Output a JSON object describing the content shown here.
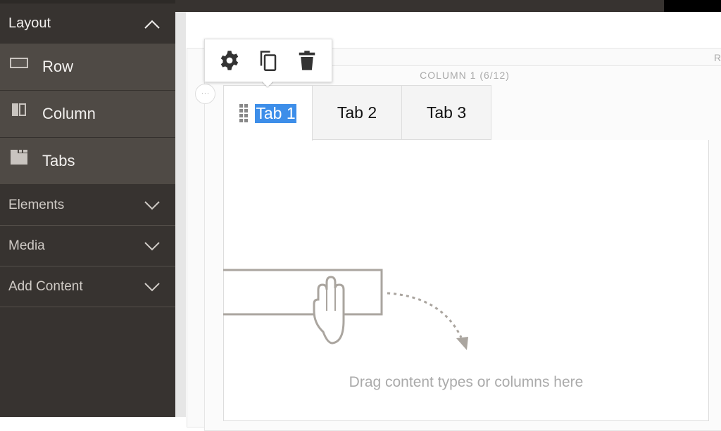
{
  "sidebar": {
    "layout": {
      "label": "Layout",
      "expanded": true,
      "items": [
        {
          "label": "Row",
          "icon": "row-icon"
        },
        {
          "label": "Column",
          "icon": "column-icon"
        },
        {
          "label": "Tabs",
          "icon": "tabs-icon"
        }
      ]
    },
    "sections": [
      {
        "label": "Elements"
      },
      {
        "label": "Media"
      },
      {
        "label": "Add Content"
      }
    ]
  },
  "stage": {
    "row_label": "R",
    "column_label": "COLUMN 1 (6/12)",
    "options_label": "···",
    "toolbar": {
      "icons": [
        "gear-icon",
        "copy-icon",
        "trash-icon"
      ]
    },
    "tabs": [
      {
        "label": "Tab 1",
        "active": true,
        "selected": true
      },
      {
        "label": "Tab 2"
      },
      {
        "label": "Tab 3"
      }
    ],
    "empty_hint": "Drag content types or columns here"
  },
  "colors": {
    "sidebar": "#373330",
    "sidebar_item": "#4f4a45",
    "selection": "#3d8ee9"
  }
}
